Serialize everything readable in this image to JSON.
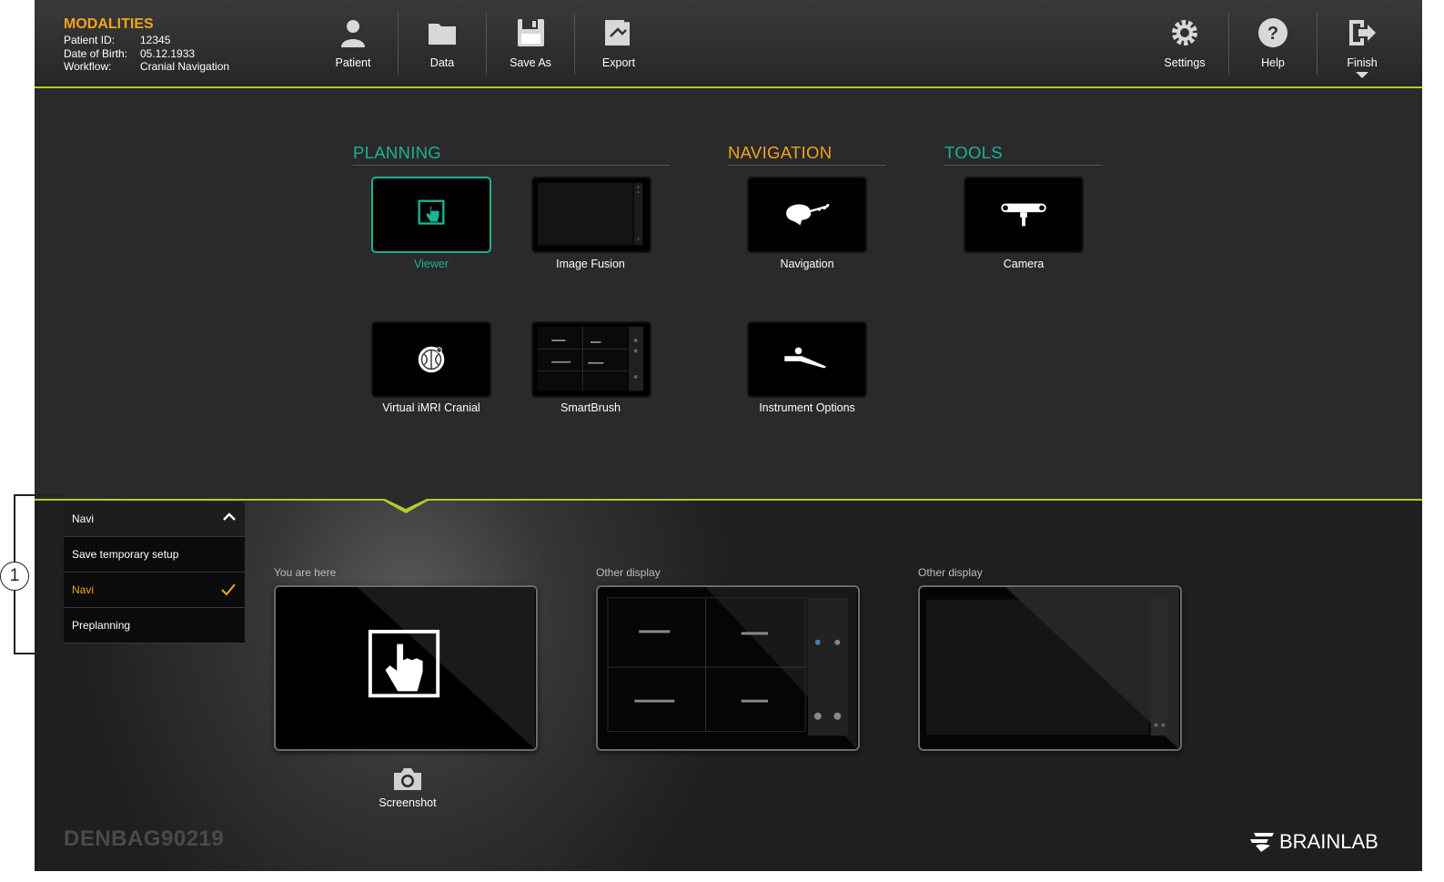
{
  "header": {
    "title": "MODALITIES",
    "patient_id_label": "Patient ID:",
    "patient_id": "12345",
    "dob_label": "Date of Birth:",
    "dob": "05.12.1933",
    "workflow_label": "Workflow:",
    "workflow": "Cranial Navigation",
    "buttons": {
      "patient": "Patient",
      "data": "Data",
      "save_as": "Save As",
      "export": "Export",
      "settings": "Settings",
      "help": "Help",
      "finish": "Finish"
    }
  },
  "sections": {
    "planning": "PLANNING",
    "navigation": "NAVIGATION",
    "tools": "TOOLS"
  },
  "tiles": {
    "viewer": "Viewer",
    "image_fusion": "Image Fusion",
    "navigation": "Navigation",
    "camera": "Camera",
    "virtual_imri": "Virtual iMRI Cranial",
    "smartbrush": "SmartBrush",
    "instrument_options": "Instrument Options"
  },
  "setup_menu": {
    "selected": "Navi",
    "items": [
      "Save temporary setup",
      "Navi",
      "Preplanning"
    ],
    "checked_item": "Navi"
  },
  "displays": {
    "current_caption": "You are here",
    "other1_caption": "Other display",
    "other2_caption": "Other display"
  },
  "screenshot_label": "Screenshot",
  "device_id": "DENBAG90219",
  "brand": "BRAINLAB",
  "callout_number": "1",
  "colors": {
    "accent_orange": "#f3a31c",
    "accent_teal": "#1ab394",
    "accent_lime": "#b6c92a"
  }
}
